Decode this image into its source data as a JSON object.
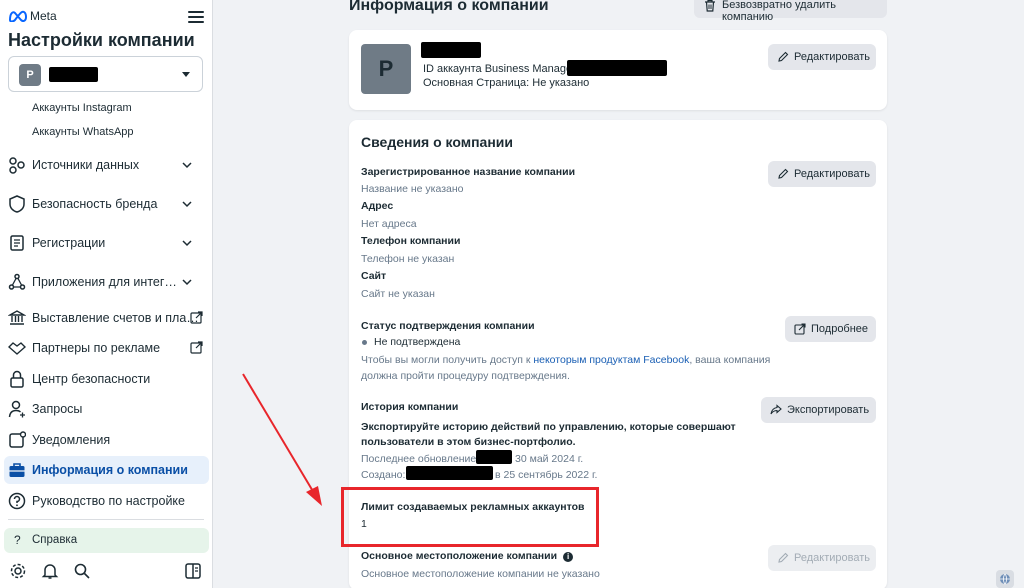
{
  "sidebar": {
    "brand": "Meta",
    "title": "Настройки компании",
    "account": {
      "avatar_letter": "P"
    },
    "sub_items": [
      "Аккаунты Instagram",
      "Аккаунты WhatsApp"
    ],
    "nav": [
      {
        "label": "Источники данных",
        "icon": "data-sources-icon"
      },
      {
        "label": "Безопасность бренда",
        "icon": "shield-icon"
      },
      {
        "label": "Регистрации",
        "icon": "registrations-icon"
      },
      {
        "label": "Приложения для интег…",
        "icon": "integrations-icon"
      },
      {
        "label": "Выставление счетов и пла…",
        "icon": "bank-icon"
      },
      {
        "label": "Партнеры по рекламе",
        "icon": "handshake-icon"
      },
      {
        "label": "Центр безопасности",
        "icon": "lock-icon"
      },
      {
        "label": "Запросы",
        "icon": "person-icon"
      },
      {
        "label": "Уведомления",
        "icon": "notifications-icon"
      },
      {
        "label": "Информация о компании",
        "icon": "briefcase-icon",
        "active": true
      },
      {
        "label": "Руководство по настройке",
        "icon": "question-icon"
      }
    ],
    "help_label": "Справка"
  },
  "main": {
    "title": "Информация о компании",
    "delete_button": "Безвозвратно удалить компанию",
    "summary": {
      "avatar_letter": "P",
      "id_label": "ID аккаунта Business Manager:",
      "main_page": "Основная Страница: Не указано",
      "edit_label": "Редактировать"
    },
    "details": {
      "title": "Сведения о компании",
      "edit_label": "Редактировать",
      "registered_name_label": "Зарегистрированное название компании",
      "registered_name_value": "Название не указано",
      "address_label": "Адрес",
      "address_value": "Нет адреса",
      "phone_label": "Телефон компании",
      "phone_value": "Телефон не указан",
      "site_label": "Сайт",
      "site_value": "Сайт не указан",
      "verification_label": "Статус подтверждения компании",
      "verification_status": "Не подтверждена",
      "verification_text_before": "Чтобы вы могли получить доступ к ",
      "verification_link": "некоторым продуктам Facebook",
      "verification_text_after": ", ваша компания",
      "verification_text_line2": "должна пройти процедуру подтверждения.",
      "more_label": "Подробнее",
      "history_label": "История компании",
      "history_desc_line1": "Экспортируйте историю действий по управлению, которые совершают",
      "history_desc_line2": "пользователи в этом бизнес-портфолио.",
      "last_update_prefix": "Последнее обновление:",
      "last_update_suffix": "30 май 2024 г.",
      "created_prefix": "Создано:",
      "created_suffix": "в 25 сентябрь 2022 г.",
      "export_label": "Экспортировать",
      "ad_limit_label": "Лимит создаваемых рекламных аккаунтов",
      "ad_limit_value": "1",
      "location_label": "Основное местоположение компании",
      "location_value": "Основное местоположение компании не указано",
      "location_edit_label": "Редактировать"
    }
  },
  "colors": {
    "accent": "#0a4fa6",
    "highlight": "#e8262b",
    "link": "#1a5fb4"
  }
}
